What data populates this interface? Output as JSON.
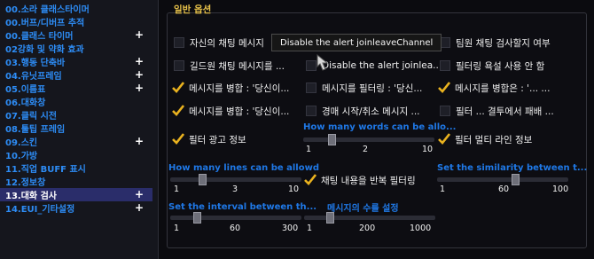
{
  "sidebar": {
    "items": [
      {
        "label": "00.소라 클래스타이머",
        "plus": ""
      },
      {
        "label": "00.버프/디버프 추적",
        "plus": ""
      },
      {
        "label": "00.클래스 타이머",
        "plus": "+"
      },
      {
        "label": "02강화 및 약화 효과",
        "plus": ""
      },
      {
        "label": "03.행동 단축바",
        "plus": "+"
      },
      {
        "label": "04.유닛프레임",
        "plus": "+"
      },
      {
        "label": "05.이름표",
        "plus": "+"
      },
      {
        "label": "06.대화창",
        "plus": ""
      },
      {
        "label": "07.클릭 시전",
        "plus": ""
      },
      {
        "label": "08.툴팁 프레임",
        "plus": ""
      },
      {
        "label": "09.스킨",
        "plus": "+"
      },
      {
        "label": "10.가방",
        "plus": ""
      },
      {
        "label": "11.직업 BUFF 표시",
        "plus": ""
      },
      {
        "label": "12.정보창",
        "plus": ""
      },
      {
        "label": "13.대화 검사",
        "plus": "+"
      },
      {
        "label": "14.EUI_기타설정",
        "plus": "+"
      }
    ]
  },
  "main": {
    "section_title": "일반 옵션",
    "options": {
      "r1c1": "자신의 채팅 메시지",
      "r1c3": "팀원 채팅 검사할지 여부",
      "r2c1": "길드원 채팅 메시지를 ...",
      "r2c2": "Disable the alert joinlea...",
      "r2c3": "필터링 욕설 사용 안 함",
      "r3c1": "메시지를 병합 : '당신이...",
      "r3c2": "메시지를 필터링 : '당신...",
      "r3c3": "메시지를 병합은 : '... ...",
      "r4c1": "메시지를 병합 : '당신이...",
      "r4c2": "경매 시작/취소 메시지 ...",
      "r4c3": "필터 ... 결투에서 패배 ...",
      "r5c1": "필터 광고 정보",
      "r5c3": "필터 멀티 라인 정보",
      "r6c2": "채팅 내용을 반복 필터링"
    },
    "sliders": {
      "words": {
        "title": "How many words can be allo...",
        "min": "1",
        "value": "2",
        "max": "10"
      },
      "lines": {
        "title": "How many lines can be allowd",
        "min": "1",
        "value": "3",
        "max": "10"
      },
      "similarity": {
        "title": "Set the similarity between t...",
        "min": "1",
        "value": "60",
        "max": "100"
      },
      "interval": {
        "title": "Set the interval between th...",
        "min": "1",
        "value": "60",
        "max": "300"
      },
      "count": {
        "title": "메시지의 수를 설정",
        "min": "1",
        "value": "200",
        "max": "1000"
      }
    },
    "tooltip": "Disable the alert joinleaveChannel"
  }
}
